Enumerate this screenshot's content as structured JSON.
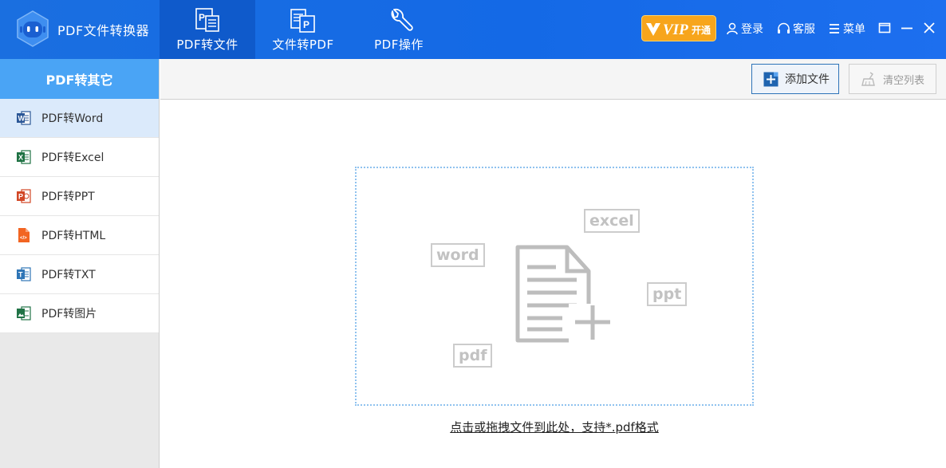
{
  "app": {
    "title": "PDF文件转换器"
  },
  "nav_tabs": [
    {
      "label": "PDF转文件",
      "icon": "pdf-to-file-icon",
      "active": true
    },
    {
      "label": "文件转PDF",
      "icon": "file-to-pdf-icon",
      "active": false
    },
    {
      "label": "PDF操作",
      "icon": "wrench-icon",
      "active": false
    }
  ],
  "header": {
    "vip": {
      "text": "VIP",
      "sub": "开通"
    },
    "login_label": "登录",
    "service_label": "客服",
    "menu_label": "菜单"
  },
  "sidebar": {
    "heading": "PDF转其它",
    "items": [
      {
        "label": "PDF转Word",
        "icon": "word-file-icon",
        "color": "#2b5797",
        "letter": "W",
        "active": true
      },
      {
        "label": "PDF转Excel",
        "icon": "excel-file-icon",
        "color": "#1f7244",
        "letter": "X",
        "active": false
      },
      {
        "label": "PDF转PPT",
        "icon": "ppt-file-icon",
        "color": "#d24726",
        "letter": "P",
        "active": false
      },
      {
        "label": "PDF转HTML",
        "icon": "html-file-icon",
        "color": "#f26522",
        "letter": "</>",
        "active": false
      },
      {
        "label": "PDF转TXT",
        "icon": "txt-file-icon",
        "color": "#2e75b6",
        "letter": "T",
        "active": false
      },
      {
        "label": "PDF转图片",
        "icon": "image-file-icon",
        "color": "#217346",
        "letter": "▲",
        "active": false
      }
    ]
  },
  "toolbar": {
    "add_label": "添加文件",
    "clear_label": "清空列表"
  },
  "dropzone": {
    "tags": [
      "word",
      "excel",
      "ppt",
      "pdf"
    ],
    "hint": "点击或拖拽文件到此处，支持*.pdf格式"
  },
  "colors": {
    "accent": "#1a6fe0",
    "sidebar_head": "#4aa4f5",
    "active_item": "#dbeafb"
  }
}
